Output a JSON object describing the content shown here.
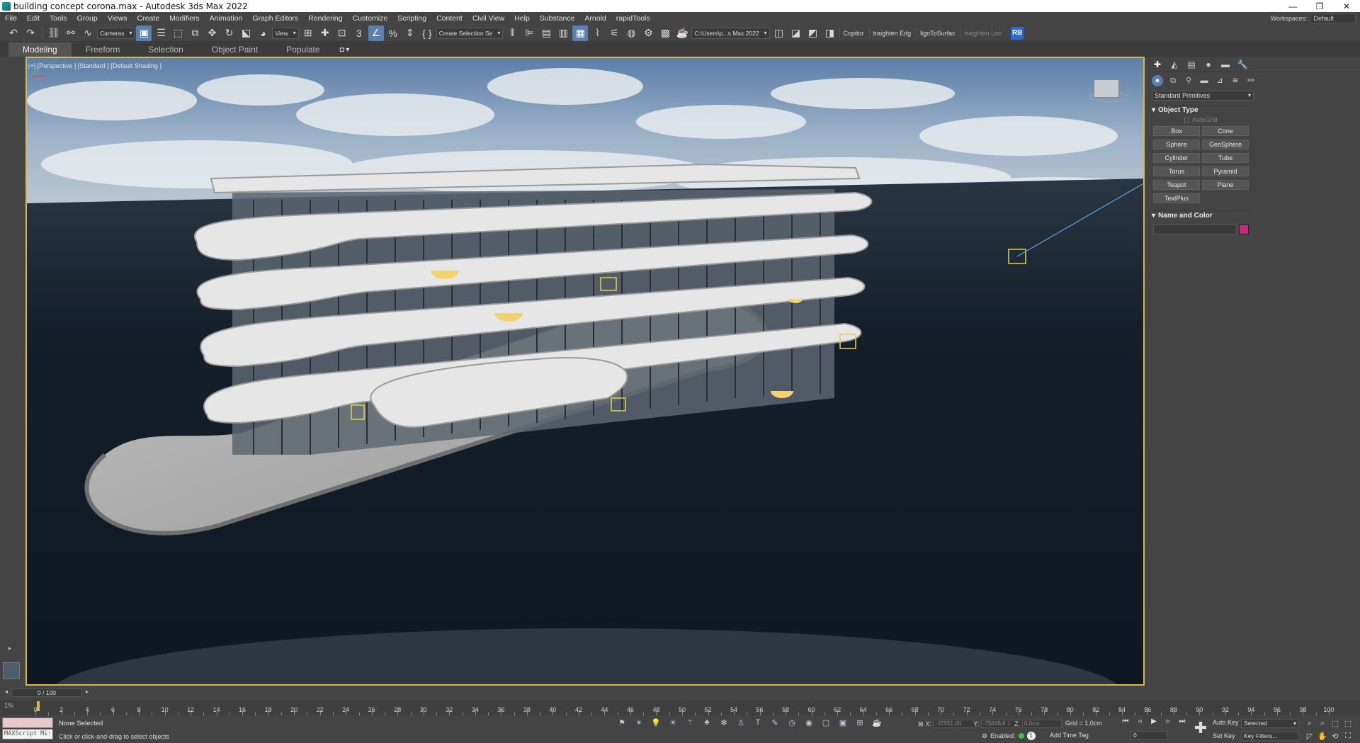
{
  "window": {
    "title": "building concept corona.max - Autodesk 3ds Max 2022",
    "controls": [
      "—",
      "❐",
      "✕"
    ]
  },
  "menu": {
    "items": [
      "File",
      "Edit",
      "Tools",
      "Group",
      "Views",
      "Create",
      "Modifiers",
      "Animation",
      "Graph Editors",
      "Rendering",
      "Customize",
      "Scripting",
      "Content",
      "Civil View",
      "Help",
      "Substance",
      "Arnold",
      "rapidTools"
    ],
    "workspaces_label": "Workspaces:",
    "workspace_value": "Default"
  },
  "toolbar": {
    "cameras_dropdown": "Cameras",
    "view_dropdown": "View",
    "selection_set": "Create Selection Se",
    "path_dropdown": "C:\\Users\\p...s Max 2022",
    "scripts": [
      "Copitor",
      "traighten Edg",
      "lignToSurfac",
      "traighten Loo"
    ],
    "rb_label": "RB"
  },
  "ribbon": {
    "tabs": [
      "Modeling",
      "Freeform",
      "Selection",
      "Object Paint",
      "Populate"
    ],
    "active_tab": "Modeling",
    "extra": "◘ ▾"
  },
  "viewport": {
    "label": "[+] [Perspective ] [Standard ] [Default Shading ]",
    "active_border_color": "#d9b84a"
  },
  "command_panel": {
    "tabs": [
      "create-icon",
      "modify-icon",
      "hierarchy-icon",
      "motion-icon",
      "display-icon",
      "utilities-icon"
    ],
    "categories": [
      "geometry-icon",
      "shapes-icon",
      "lights-icon",
      "cameras-icon",
      "helpers-icon",
      "spacewarps-icon",
      "systems-icon"
    ],
    "primitives_dropdown": "Standard Primitives",
    "object_type_title": "Object Type",
    "autogrid_label": "AutoGrid",
    "object_buttons": [
      "Box",
      "Cone",
      "Sphere",
      "GeoSphere",
      "Cylinder",
      "Tube",
      "Torus",
      "Pyramid",
      "Teapot",
      "Plane",
      "TextPlus"
    ],
    "name_color_title": "Name and Color",
    "swatch_color": "#c8287a"
  },
  "timeline": {
    "frame_display": "0 / 100",
    "ticks": [
      "0",
      "2",
      "4",
      "6",
      "8",
      "10",
      "12",
      "14",
      "16",
      "18",
      "20",
      "22",
      "24",
      "26",
      "28",
      "30",
      "32",
      "34",
      "36",
      "38",
      "40",
      "42",
      "44",
      "46",
      "48",
      "50",
      "52",
      "54",
      "56",
      "58",
      "60",
      "62",
      "64",
      "66",
      "68",
      "70",
      "72",
      "74",
      "76",
      "78",
      "80",
      "82",
      "84",
      "86",
      "88",
      "90",
      "92",
      "94",
      "96",
      "98",
      "100"
    ],
    "corner_label": "1%"
  },
  "status": {
    "maxscript_label": "MAXScript Mi:",
    "selection": "None Selected",
    "prompt": "Click or click-and-drag to select objects",
    "x_label": "X:",
    "x_value": "-37551,00",
    "y_label": "Y:",
    "y_value": "-75648,8 1",
    "z_label": "Z:",
    "z_value": "0,0cm",
    "grid": "Grid = 1,0cm",
    "enabled_label": "Enabled:",
    "enabled_count": "1",
    "add_time_tag": "Add Time Tag",
    "current_frame": "0",
    "auto_key": "Auto Key",
    "set_key": "Set Key",
    "auto_key_mode": "Selected",
    "key_filters": "Key Filters..."
  }
}
